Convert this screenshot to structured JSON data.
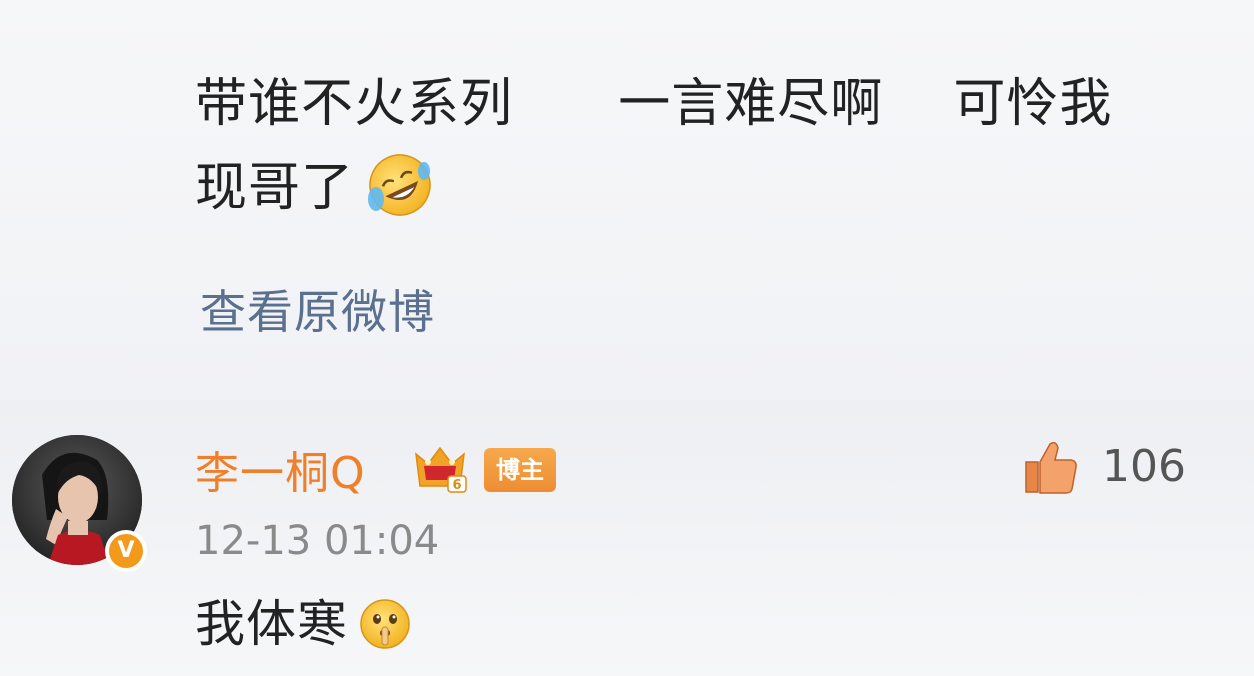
{
  "post": {
    "text_segments": [
      "带谁不火系列",
      "一言难尽啊",
      "可怜我",
      "现哥了"
    ],
    "emoji": "laugh-cry-icon",
    "view_original_label": "查看原微博",
    "link_color": "#5b6f8f"
  },
  "comment": {
    "username": "李一桐Q",
    "username_color": "#f07f2a",
    "level_icon": "crown-level-icon",
    "level_number": "6",
    "host_badge_label": "博主",
    "verified_label": "V",
    "timestamp": "12-13 01:04",
    "text": "我体寒",
    "emoji": "shush-face-icon",
    "like_count": "106"
  }
}
